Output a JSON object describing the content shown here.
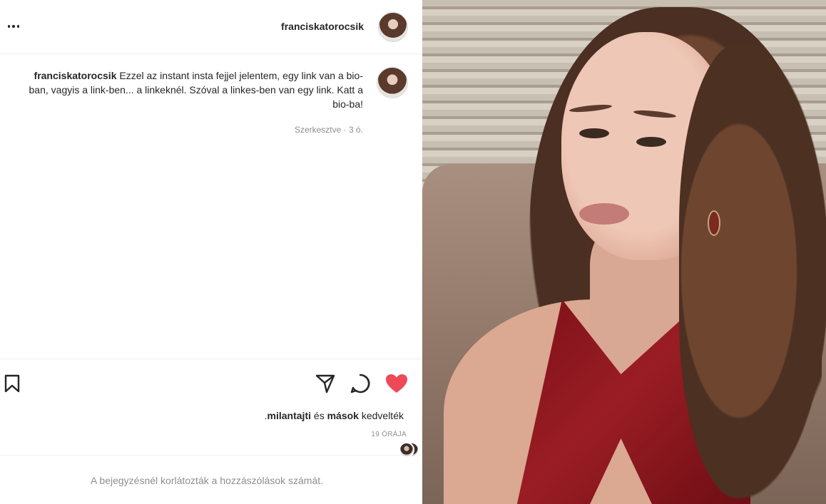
{
  "post": {
    "username": "franciskatorocsik",
    "caption_username": "franciskatorocsik",
    "caption_text": "Ezzel az instant insta fejjel jelentem, egy link van a bio-ban, vagyis a link-ben... a linkeknél. Szóval a linkes-ben van egy link. Katt a bio-ba!",
    "edited_meta": "Szerkesztve · 3 ó.",
    "likes_user": "milantajti",
    "likes_middle": " és ",
    "likes_others": "mások",
    "likes_suffix": " kedvelték.",
    "timestamp": "19 ÓRÁJA",
    "comments_disabled_text": "A bejegyzésnél korlátozták a hozzászólások számát."
  },
  "icons": {
    "more": "more-horizontal-icon",
    "bookmark": "bookmark-icon",
    "share": "send-icon",
    "comment": "comment-bubble-icon",
    "like": "heart-filled-icon"
  },
  "colors": {
    "like_red": "#ed4956",
    "text_primary": "#262626",
    "text_secondary": "#8e8e8e",
    "divider": "#efefef"
  }
}
